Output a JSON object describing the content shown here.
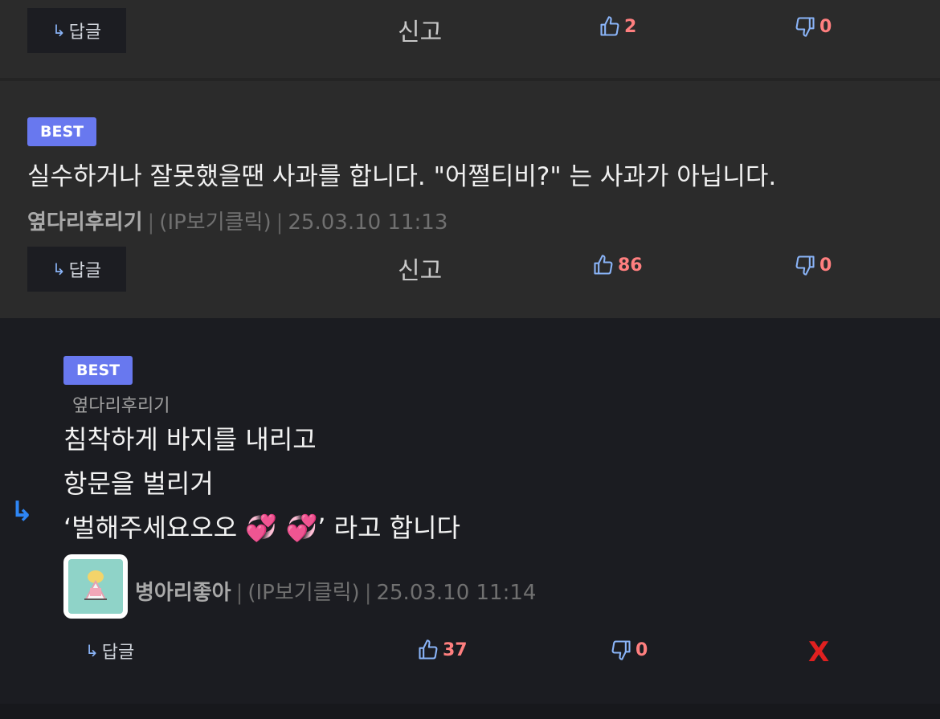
{
  "icons": {
    "reply": "reply-arrow-icon",
    "thumbs_up": "thumbs-up-icon",
    "thumbs_down": "thumbs-down-icon",
    "side_reply": "reply-indicator-icon"
  },
  "colors": {
    "badge": "#6878ef",
    "count": "#ff7f7f",
    "delete": "#e02020",
    "icon_blue": "#8ab4f8"
  },
  "top_actions": {
    "reply_arrow": "↳",
    "reply_label": "답글",
    "report_label": "신고",
    "likes": "2",
    "dislikes": "0"
  },
  "comment1": {
    "badge": "BEST",
    "text": "실수하거나 잘못했을땐 사과를 합니다. \"어쩔티비?\" 는 사과가 아닙니다.",
    "author": "옆다리후리기",
    "sep1": "|",
    "ip": "(IP보기클릭)",
    "sep2": "|",
    "timestamp": "25.03.10 11:13",
    "reply_arrow": "↳",
    "reply_label": "답글",
    "report_label": "신고",
    "likes": "86",
    "dislikes": "0"
  },
  "comment2": {
    "badge": "BEST",
    "reply_to": "옆다리후리기",
    "side_arrow": "↳",
    "lines": [
      "침착하게 바지를 내리고",
      "항문을 벌리거",
      "‘벌해주세요오오 💞 💞’ 라고 합니다"
    ],
    "author": "병아리좋아",
    "sep1": "|",
    "ip": "(IP보기클릭)",
    "sep2": "|",
    "timestamp": "25.03.10 11:14",
    "reply_arrow": "↳",
    "reply_label": "답글",
    "likes": "37",
    "dislikes": "0",
    "delete_label": "X"
  }
}
